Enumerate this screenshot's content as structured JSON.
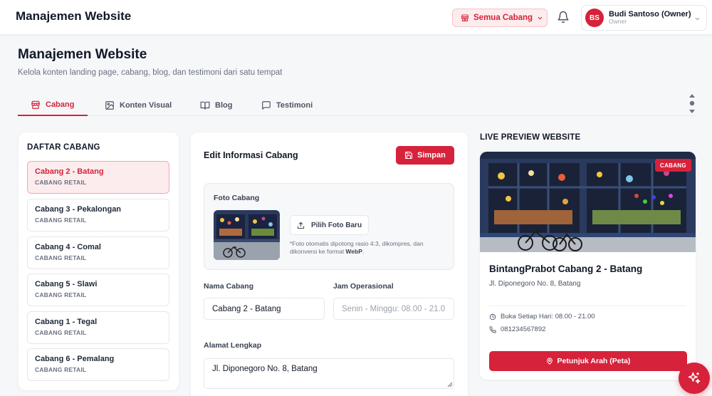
{
  "header": {
    "app_title": "Manajemen Website",
    "branch_selector": "Semua Cabang",
    "user": {
      "initials": "BS",
      "name": "Budi Santoso (Owner)",
      "role": "Owner"
    }
  },
  "page": {
    "title": "Manajemen Website",
    "subtitle": "Kelola konten landing page, cabang, blog, dan testimoni dari satu tempat"
  },
  "tabs": [
    {
      "label": "Cabang",
      "icon": "store-icon",
      "active": true
    },
    {
      "label": "Konten Visual",
      "icon": "image-icon",
      "active": false
    },
    {
      "label": "Blog",
      "icon": "book-icon",
      "active": false
    },
    {
      "label": "Testimoni",
      "icon": "message-icon",
      "active": false
    }
  ],
  "branch_list": {
    "title": "DAFTAR CABANG",
    "items": [
      {
        "name": "Cabang 2 - Batang",
        "type": "CABANG RETAIL",
        "active": true
      },
      {
        "name": "Cabang 3 - Pekalongan",
        "type": "CABANG RETAIL",
        "active": false
      },
      {
        "name": "Cabang 4 - Comal",
        "type": "CABANG RETAIL",
        "active": false
      },
      {
        "name": "Cabang 5 - Slawi",
        "type": "CABANG RETAIL",
        "active": false
      },
      {
        "name": "Cabang 1 - Tegal",
        "type": "CABANG RETAIL",
        "active": false
      },
      {
        "name": "Cabang 6 - Pemalang",
        "type": "CABANG RETAIL",
        "active": false
      }
    ]
  },
  "edit_form": {
    "title": "Edit Informasi Cabang",
    "save_label": "Simpan",
    "photo_label": "Foto Cabang",
    "pick_photo_label": "Pilih Foto Baru",
    "photo_note_prefix": "*Foto otomatis dipotong rasio 4:3, dikompres, dan dikonversi ke format ",
    "photo_note_format": "WebP",
    "photo_note_suffix": ".",
    "name_label": "Nama Cabang",
    "name_value": "Cabang 2 - Batang",
    "hours_label": "Jam Operasional",
    "hours_value": "Senin - Minggu: 08.00 - 21.0",
    "address_label": "Alamat Lengkap",
    "address_value": "Jl. Diponegoro No. 8, Batang"
  },
  "preview": {
    "section_title": "LIVE PREVIEW WEBSITE",
    "badge": "CABANG",
    "name": "BintangPrabot Cabang 2 - Batang",
    "address": "Jl. Diponegoro No. 8, Batang",
    "hours": "Buka Setiap Hari: 08.00 - 21.00",
    "phone": "081234567892",
    "directions_label": "Petunjuk Arah (Peta)"
  },
  "colors": {
    "accent": "#d6223a",
    "accent_soft": "#fdecee",
    "background": "#f6f7f9"
  }
}
